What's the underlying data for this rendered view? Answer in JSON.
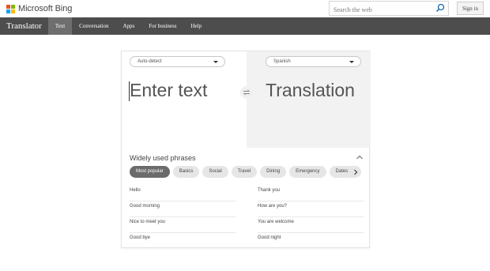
{
  "header": {
    "logo_text": "Microsoft Bing",
    "search_placeholder": "Search the web",
    "signin_label": "Sign in"
  },
  "nav": {
    "brand": "Translator",
    "tabs": [
      "Text",
      "Conversation",
      "Apps",
      "For business",
      "Help"
    ],
    "active_tab": "Text"
  },
  "translator": {
    "source_lang": "Auto-detect",
    "target_lang": "Spanish",
    "source_placeholder": "Enter text",
    "target_placeholder": "Translation"
  },
  "phrases": {
    "title": "Widely used phrases",
    "categories": [
      "Most popular",
      "Basics",
      "Social",
      "Travel",
      "Dining",
      "Emergency",
      "Dates"
    ],
    "active_category": "Most popular",
    "left": [
      "Hello",
      "Good morning",
      "Nice to meet you",
      "Good bye"
    ],
    "right": [
      "Thank you",
      "How are you?",
      "You are welcome",
      "Good night"
    ]
  },
  "colors": {
    "nav_bg": "#4d4d4d",
    "nav_active": "#6e6e6e",
    "ms_red": "#f25022",
    "ms_green": "#7fba00",
    "ms_blue": "#00a4ef",
    "ms_yellow": "#ffb900"
  },
  "icons": [
    "microsoft-logo-icon",
    "search-icon",
    "chevron-down-icon",
    "swap-icon",
    "chevron-up-icon",
    "chevron-right-icon"
  ]
}
